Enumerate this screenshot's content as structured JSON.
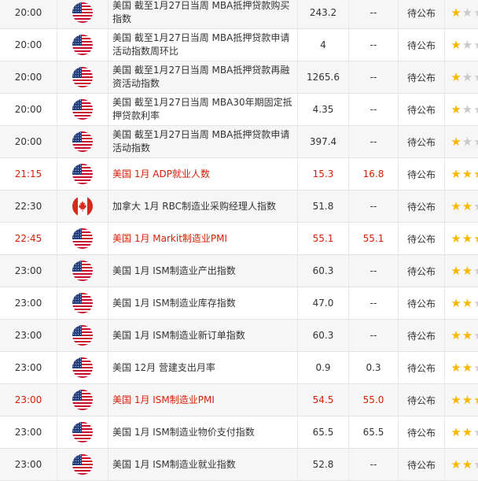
{
  "colors": {
    "important_text": "#d81e06",
    "star_active": "#f6b800",
    "star_inactive": "#c9c9c9"
  },
  "rows": [
    {
      "time": "20:00",
      "flag": "us-flag-icon",
      "event": "美国 截至1月27日当周 MBA抵押贷款购买指数",
      "actual": "243.2",
      "forecast": "--",
      "previous": "待公布",
      "stars": 1,
      "important": false
    },
    {
      "time": "20:00",
      "flag": "us-flag-icon",
      "event": "美国 截至1月27日当周 MBA抵押贷款申请活动指数周环比",
      "actual": "4",
      "forecast": "--",
      "previous": "待公布",
      "stars": 1,
      "important": false
    },
    {
      "time": "20:00",
      "flag": "us-flag-icon",
      "event": "美国 截至1月27日当周 MBA抵押贷款再融资活动指数",
      "actual": "1265.6",
      "forecast": "--",
      "previous": "待公布",
      "stars": 1,
      "important": false
    },
    {
      "time": "20:00",
      "flag": "us-flag-icon",
      "event": "美国 截至1月27日当周 MBA30年期固定抵押贷款利率",
      "actual": "4.35",
      "forecast": "--",
      "previous": "待公布",
      "stars": 1,
      "important": false
    },
    {
      "time": "20:00",
      "flag": "us-flag-icon",
      "event": "美国 截至1月27日当周 MBA抵押贷款申请活动指数",
      "actual": "397.4",
      "forecast": "--",
      "previous": "待公布",
      "stars": 1,
      "important": false
    },
    {
      "time": "21:15",
      "flag": "us-flag-icon",
      "event": "美国 1月 ADP就业人数",
      "actual": "15.3",
      "forecast": "16.8",
      "previous": "待公布",
      "stars": 3,
      "important": true
    },
    {
      "time": "22:30",
      "flag": "canada-flag-icon",
      "event": "加拿大 1月 RBC制造业采购经理人指数",
      "actual": "51.8",
      "forecast": "--",
      "previous": "待公布",
      "stars": 2,
      "important": false
    },
    {
      "time": "22:45",
      "flag": "us-flag-icon",
      "event": "美国 1月 Markit制造业PMI",
      "actual": "55.1",
      "forecast": "55.1",
      "previous": "待公布",
      "stars": 3,
      "important": true
    },
    {
      "time": "23:00",
      "flag": "us-flag-icon",
      "event": "美国 1月 ISM制造业产出指数",
      "actual": "60.3",
      "forecast": "--",
      "previous": "待公布",
      "stars": 2,
      "important": false
    },
    {
      "time": "23:00",
      "flag": "us-flag-icon",
      "event": "美国 1月 ISM制造业库存指数",
      "actual": "47.0",
      "forecast": "--",
      "previous": "待公布",
      "stars": 2,
      "important": false
    },
    {
      "time": "23:00",
      "flag": "us-flag-icon",
      "event": "美国 1月 ISM制造业新订单指数",
      "actual": "60.3",
      "forecast": "--",
      "previous": "待公布",
      "stars": 2,
      "important": false
    },
    {
      "time": "23:00",
      "flag": "us-flag-icon",
      "event": "美国 12月 营建支出月率",
      "actual": "0.9",
      "forecast": "0.3",
      "previous": "待公布",
      "stars": 2,
      "important": false
    },
    {
      "time": "23:00",
      "flag": "us-flag-icon",
      "event": "美国 1月 ISM制造业PMI",
      "actual": "54.5",
      "forecast": "55.0",
      "previous": "待公布",
      "stars": 3,
      "important": true
    },
    {
      "time": "23:00",
      "flag": "us-flag-icon",
      "event": "美国 1月 ISM制造业物价支付指数",
      "actual": "65.5",
      "forecast": "65.5",
      "previous": "待公布",
      "stars": 2,
      "important": false
    },
    {
      "time": "23:00",
      "flag": "us-flag-icon",
      "event": "美国 1月 ISM制造业就业指数",
      "actual": "52.8",
      "forecast": "--",
      "previous": "待公布",
      "stars": 2,
      "important": false
    }
  ]
}
